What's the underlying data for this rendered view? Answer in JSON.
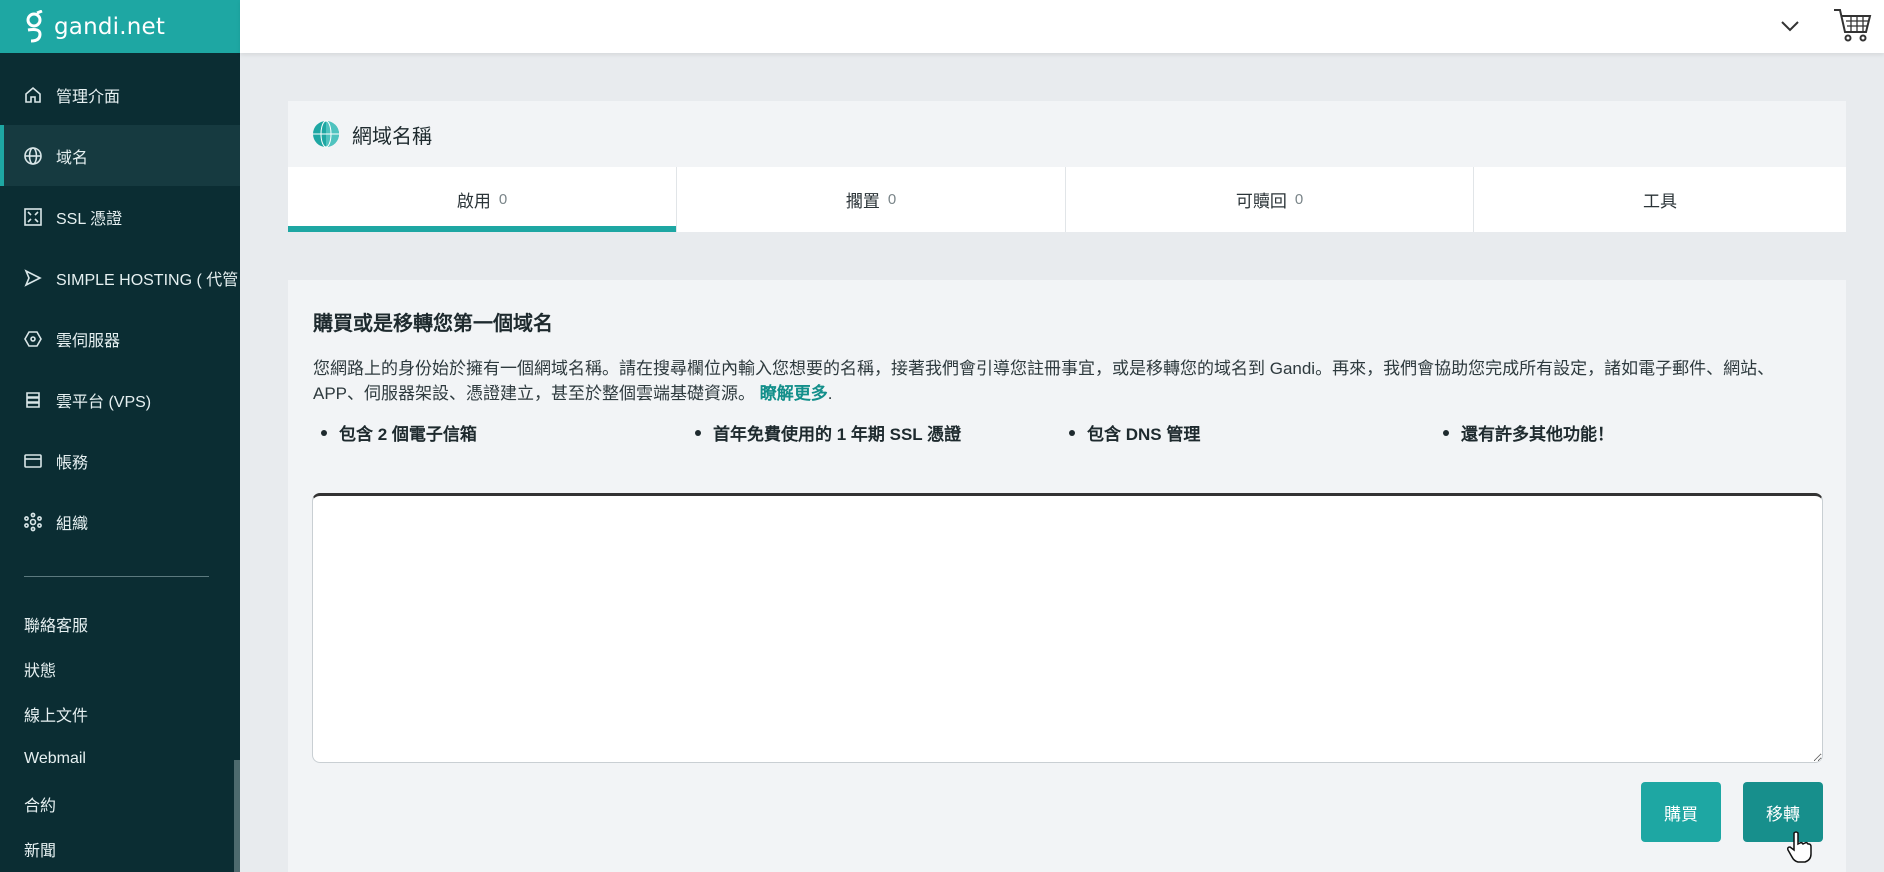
{
  "brand": {
    "name": "gandi.net"
  },
  "sidebar": {
    "items": [
      {
        "label": "管理介面",
        "icon": "home-icon"
      },
      {
        "label": "域名",
        "icon": "globe-icon",
        "active": true
      },
      {
        "label": "SSL 憑證",
        "icon": "certificate-icon"
      },
      {
        "label": "SIMPLE HOSTING ( 代管",
        "icon": "send-icon"
      },
      {
        "label": "雲伺服器",
        "icon": "cloud-server-icon"
      },
      {
        "label": "雲平台 (VPS)",
        "icon": "vps-icon"
      },
      {
        "label": "帳務",
        "icon": "credit-card-icon"
      },
      {
        "label": "組織",
        "icon": "organization-icon"
      }
    ],
    "links": [
      "聯絡客服",
      "狀態",
      "線上文件",
      "Webmail",
      "合約",
      "新聞"
    ]
  },
  "topbar": {
    "dropdown_icon": "chevron-down-icon",
    "cart_icon": "shopping-cart-icon"
  },
  "panel": {
    "title": "網域名稱",
    "tabs": [
      {
        "label": "啟用",
        "count": "0",
        "active": true
      },
      {
        "label": "擱置",
        "count": "0"
      },
      {
        "label": "可贖回",
        "count": "0"
      },
      {
        "label": "工具",
        "count": ""
      }
    ]
  },
  "card": {
    "title": "購買或是移轉您第一個域名",
    "description": "您網路上的身份始於擁有一個網域名稱。請在搜尋欄位內輸入您想要的名稱，接著我們會引導您註冊事宜，或是移轉您的域名到 Gandi。再來，我們會協助您完成所有設定，諸如電子郵件、網站、APP、伺服器架設、憑證建立，甚至於整個雲端基礎資源。",
    "learn_more": "瞭解更多",
    "learn_more_suffix": ".",
    "features": [
      "包含 2 個電子信箱",
      "首年免費使用的 1 年期 SSL 憑證",
      "包含 DNS 管理",
      "還有許多其他功能！"
    ],
    "search_value": "",
    "buy_label": "購買",
    "transfer_label": "移轉"
  },
  "colors": {
    "accent": "#1ea7a3",
    "sidebar_bg": "#0b2d33"
  }
}
